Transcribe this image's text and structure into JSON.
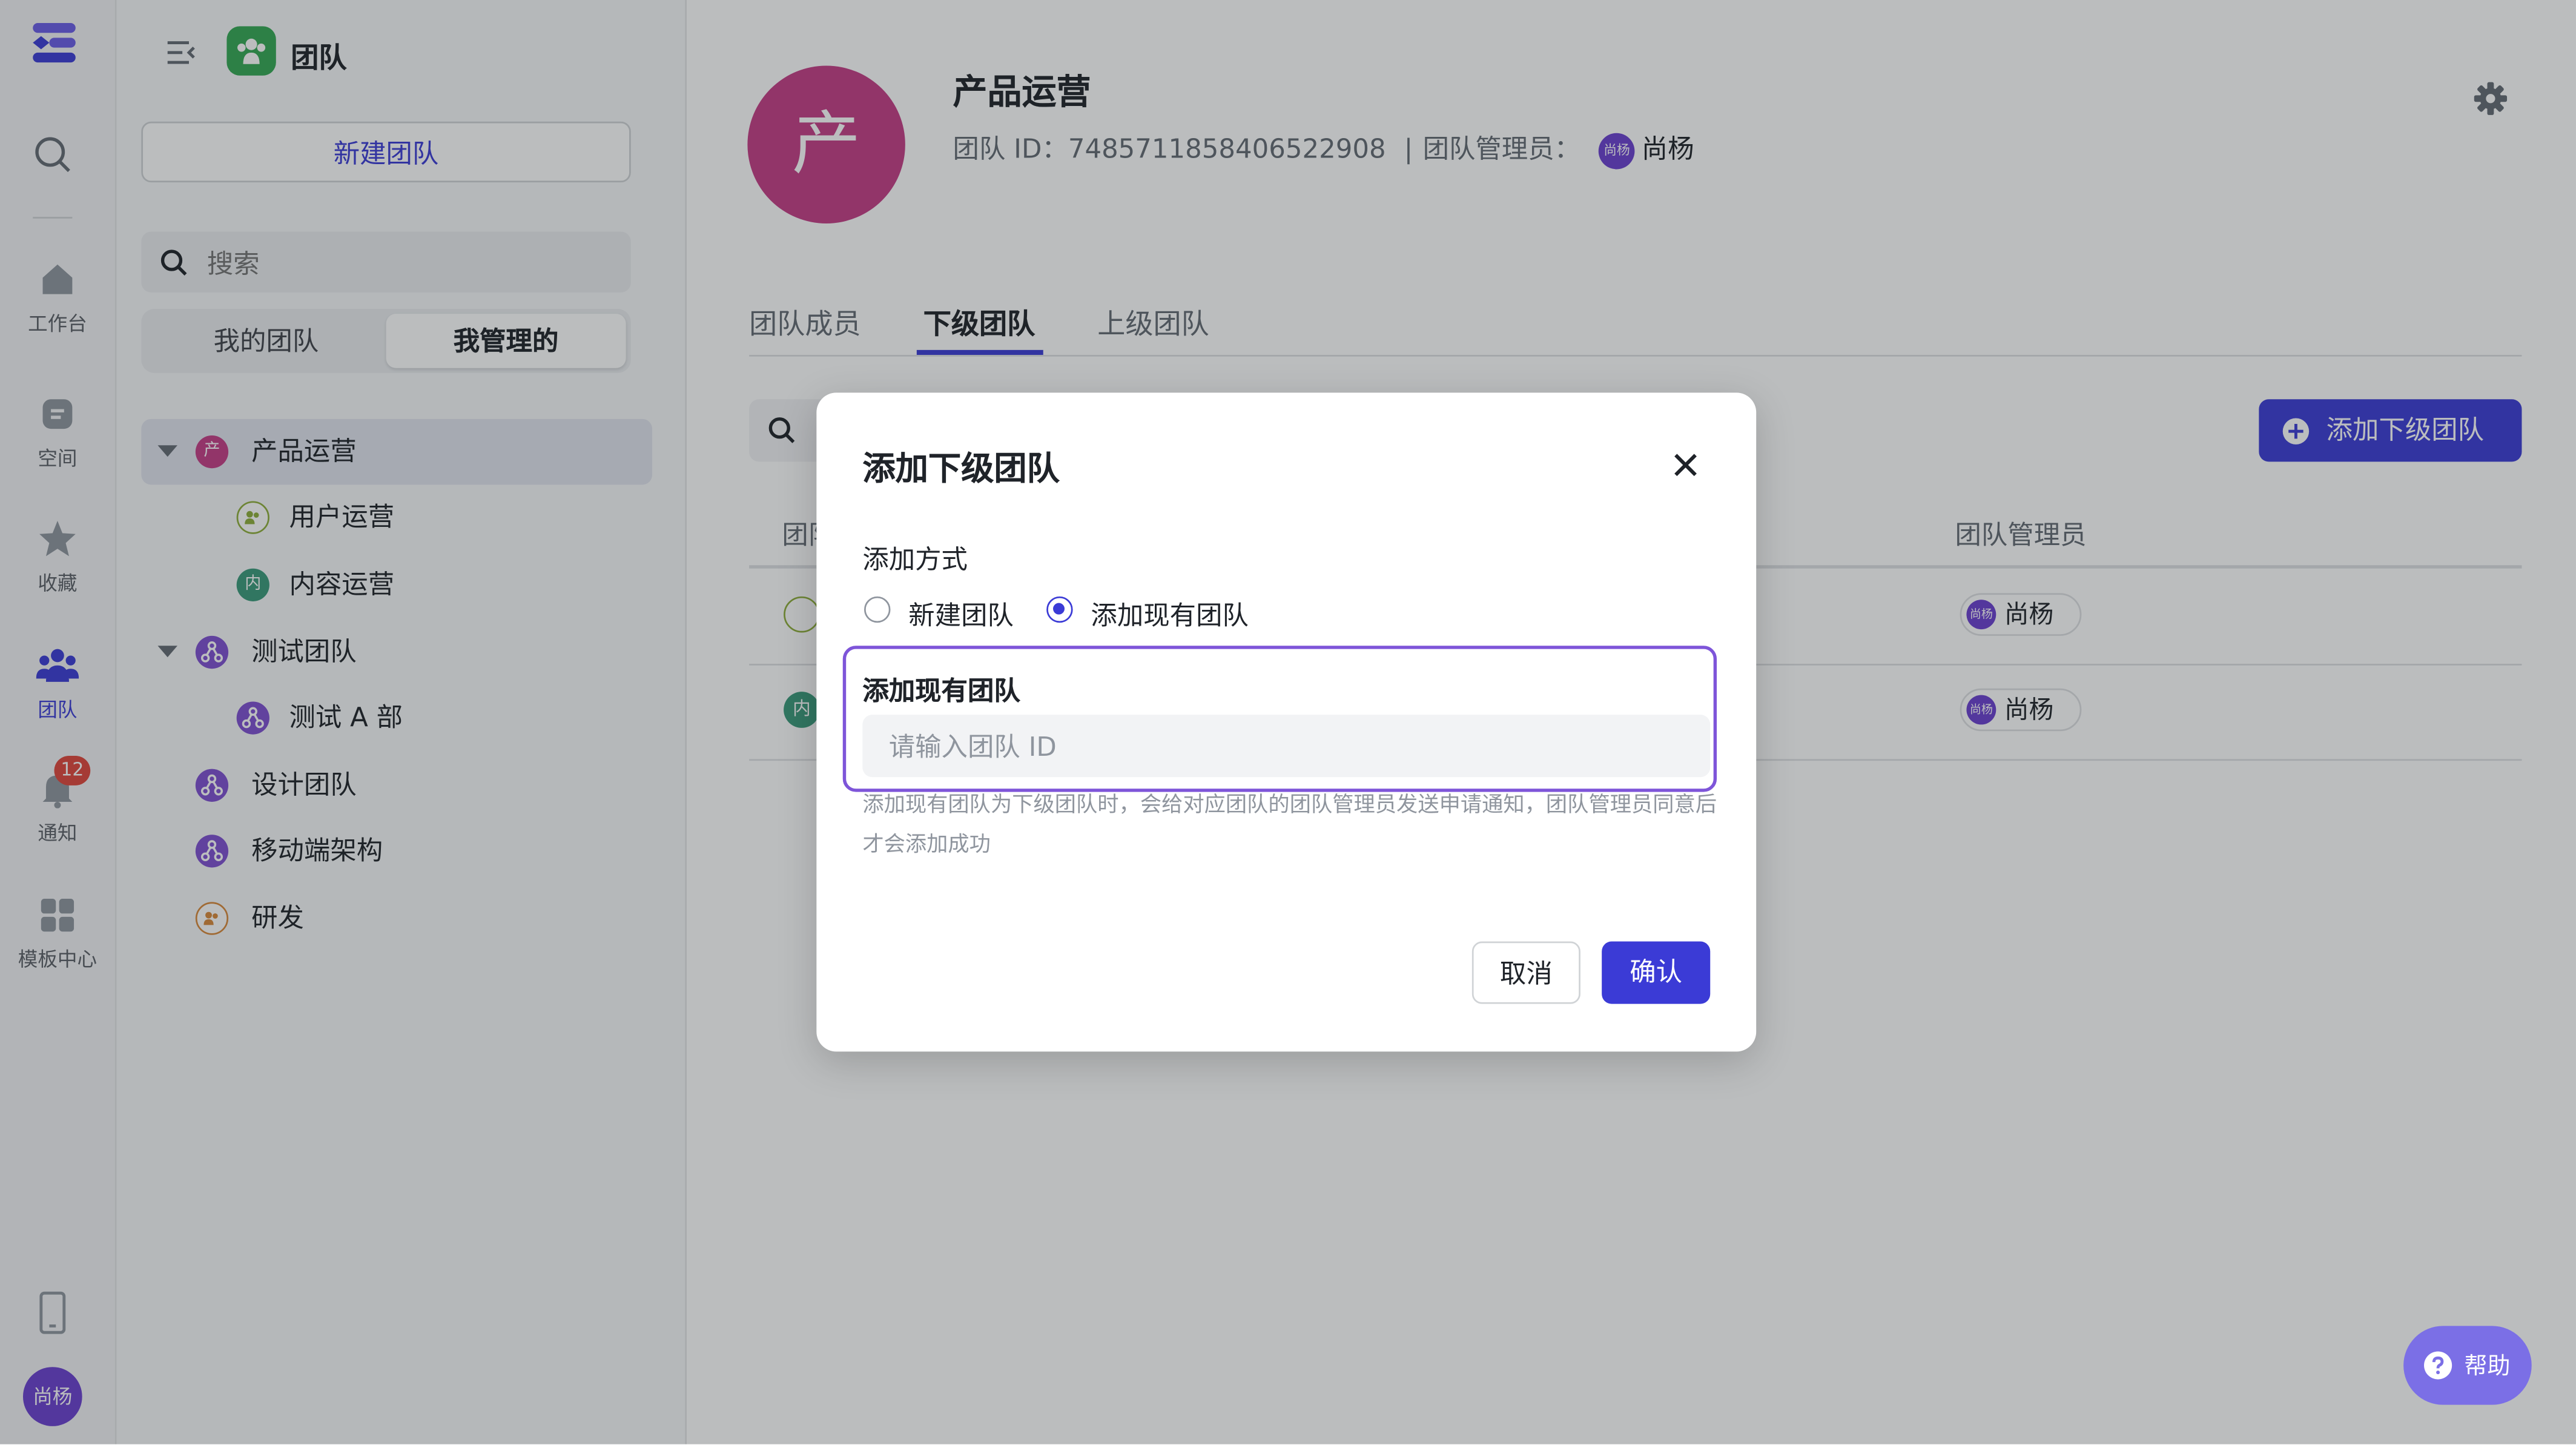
{
  "rail": {
    "items": [
      {
        "label": "工作台",
        "icon": "home-icon"
      },
      {
        "label": "空间",
        "icon": "space-icon"
      },
      {
        "label": "收藏",
        "icon": "star-icon"
      },
      {
        "label": "团队",
        "icon": "team-icon",
        "active": true
      },
      {
        "label": "通知",
        "icon": "bell-icon",
        "badge": "12"
      },
      {
        "label": "模板中心",
        "icon": "template-icon"
      }
    ],
    "user_avatar": "尚杨"
  },
  "sidebar": {
    "title": "团队",
    "new_team_button": "新建团队",
    "search_placeholder": "搜索",
    "segments": [
      "我的团队",
      "我管理的"
    ],
    "active_segment": "我管理的",
    "tree": [
      {
        "label": "产品运营",
        "avatar": "产",
        "level": 0,
        "expanded": true,
        "selected": true
      },
      {
        "label": "用户运营",
        "avatar": "",
        "level": 1
      },
      {
        "label": "内容运营",
        "avatar": "内",
        "level": 1
      },
      {
        "label": "测试团队",
        "avatar": "",
        "level": 0,
        "expanded": true
      },
      {
        "label": "测试 A 部",
        "avatar": "",
        "level": 1
      },
      {
        "label": "设计团队",
        "avatar": "",
        "level": 0
      },
      {
        "label": "移动端架构",
        "avatar": "",
        "level": 0
      },
      {
        "label": "研发",
        "avatar": "",
        "level": 0
      }
    ]
  },
  "team": {
    "avatar_char": "产",
    "name": "产品运营",
    "id_label": "团队 ID：",
    "id_value": "7485711858406522908",
    "separator": "|",
    "admin_label": "团队管理员：",
    "admin_avatar": "尚杨",
    "admin_name": "尚杨"
  },
  "tabs": [
    "团队成员",
    "下级团队",
    "上级团队"
  ],
  "active_tab": "下级团队",
  "content": {
    "add_button": "添加下级团队",
    "col_team_visible": "团队",
    "col_admin": "团队管理员",
    "rows": [
      {
        "team_avatar": "",
        "admin_avatar": "尚杨",
        "admin": "尚杨"
      },
      {
        "team_avatar": "内",
        "admin_avatar": "尚杨",
        "admin": "尚杨"
      }
    ]
  },
  "modal": {
    "title": "添加下级团队",
    "method_label": "添加方式",
    "option_new": "新建团队",
    "option_existing": "添加现有团队",
    "selected_option": "添加现有团队",
    "field_title": "添加现有团队",
    "input_placeholder": "请输入团队 ID",
    "input_value": "",
    "hint": "添加现有团队为下级团队时，会给对应团队的团队管理员发送申请通知，团队管理员同意后才会添加成功",
    "cancel": "取消",
    "confirm": "确认"
  },
  "help_button": "帮助",
  "colors": {
    "accent": "#3b3bd6",
    "team_avatar": "#c43d86",
    "input_focus": "#7e55d9",
    "notification_badge": "#e0453b"
  }
}
